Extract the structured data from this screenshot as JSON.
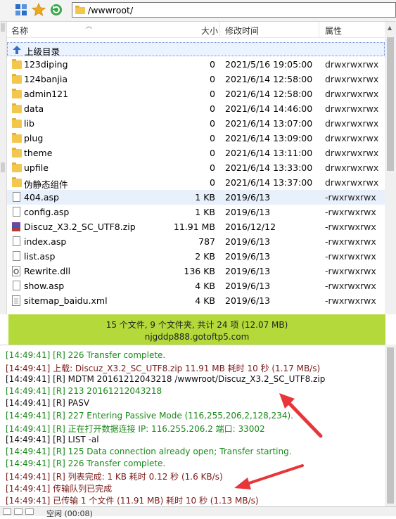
{
  "toolbar": {
    "path": "/wwwroot/"
  },
  "columns": {
    "name": "名称",
    "size": "大小",
    "modified": "修改时间",
    "attributes": "属性"
  },
  "parent_dir": "上级目录",
  "files": [
    {
      "name": "123diping",
      "size": "0",
      "modified": "2021/5/16 19:05:00",
      "attr": "drwxrwxrwx",
      "type": "folder"
    },
    {
      "name": "124banjia",
      "size": "0",
      "modified": "2021/6/14 12:58:00",
      "attr": "drwxrwxrwx",
      "type": "folder"
    },
    {
      "name": "admin121",
      "size": "0",
      "modified": "2021/6/14 12:58:00",
      "attr": "drwxrwxrwx",
      "type": "folder"
    },
    {
      "name": "data",
      "size": "0",
      "modified": "2021/6/14 14:46:00",
      "attr": "drwxrwxrwx",
      "type": "folder"
    },
    {
      "name": "lib",
      "size": "0",
      "modified": "2021/6/14 13:07:00",
      "attr": "drwxrwxrwx",
      "type": "folder"
    },
    {
      "name": "plug",
      "size": "0",
      "modified": "2021/6/14 13:09:00",
      "attr": "drwxrwxrwx",
      "type": "folder"
    },
    {
      "name": "theme",
      "size": "0",
      "modified": "2021/6/14 13:11:00",
      "attr": "drwxrwxrwx",
      "type": "folder"
    },
    {
      "name": "upfile",
      "size": "0",
      "modified": "2021/6/14 13:33:00",
      "attr": "drwxrwxrwx",
      "type": "folder"
    },
    {
      "name": "伪静态组件",
      "size": "0",
      "modified": "2021/6/14 13:37:00",
      "attr": "drwxrwxrwx",
      "type": "folder"
    },
    {
      "name": "404.asp",
      "size": "1 KB",
      "modified": "2019/6/13",
      "attr": "-rwxrwxrwx",
      "type": "file"
    },
    {
      "name": "config.asp",
      "size": "1 KB",
      "modified": "2019/6/13",
      "attr": "-rwxrwxrwx",
      "type": "file"
    },
    {
      "name": "Discuz_X3.2_SC_UTF8.zip",
      "size": "11.91 MB",
      "modified": "2016/12/12",
      "attr": "-rwxrwxrwx",
      "type": "archive"
    },
    {
      "name": "index.asp",
      "size": "787",
      "modified": "2019/6/13",
      "attr": "-rwxrwxrwx",
      "type": "file"
    },
    {
      "name": "list.asp",
      "size": "2 KB",
      "modified": "2019/6/13",
      "attr": "-rwxrwxrwx",
      "type": "file"
    },
    {
      "name": "Rewrite.dll",
      "size": "136 KB",
      "modified": "2019/6/13",
      "attr": "-rwxrwxrwx",
      "type": "dll"
    },
    {
      "name": "show.asp",
      "size": "4 KB",
      "modified": "2019/6/13",
      "attr": "-rwxrwxrwx",
      "type": "file"
    },
    {
      "name": "sitemap_baidu.xml",
      "size": "4 KB",
      "modified": "2019/6/13",
      "attr": "-rwxrwxrwx",
      "type": "xml"
    }
  ],
  "status": {
    "summary": "15 个文件, 9 个文件夹, 共计 24 项 (12.07 MB)",
    "host": "njgddp888.gotoftp5.com"
  },
  "log": [
    {
      "text": "[14:49:41] [R] 226 Transfer complete.",
      "color": "#1a8a1a"
    },
    {
      "text": "[14:49:41] 上载: Discuz_X3.2_SC_UTF8.zip 11.91 MB 耗时 10 秒 (1.17 MB/s)",
      "color": "#7a1a1a"
    },
    {
      "text": "[14:49:41] [R] MDTM 20161212043218 /wwwroot/Discuz_X3.2_SC_UTF8.zip",
      "color": "#111111"
    },
    {
      "text": "[14:49:41] [R] 213 20161212043218",
      "color": "#1a8a1a"
    },
    {
      "text": "[14:49:41] [R] PASV",
      "color": "#111111"
    },
    {
      "text": "[14:49:41] [R] 227 Entering Passive Mode (116,255,206,2,128,234).",
      "color": "#1a8a1a"
    },
    {
      "text": "[14:49:41] [R] 正在打开数据连接 IP: 116.255.206.2 端口: 33002",
      "color": "#1a8a1a"
    },
    {
      "text": "[14:49:41] [R] LIST -al",
      "color": "#111111"
    },
    {
      "text": "[14:49:41] [R] 125 Data connection already open; Transfer starting.",
      "color": "#1a8a1a"
    },
    {
      "text": "[14:49:41] [R] 226 Transfer complete.",
      "color": "#1a8a1a"
    },
    {
      "text": "[14:49:41] [R] 列表完成: 1 KB 耗时 0.12 秒 (1.6 KB/s)",
      "color": "#7a1a1a"
    },
    {
      "text": "[14:49:41] 传输队列已完成",
      "color": "#7a1a1a"
    },
    {
      "text": "[14:49:41] 已传输 1 个文件 (11.91 MB) 耗时 10 秒 (1.13 MB/s)",
      "color": "#7a1a1a"
    }
  ],
  "bottombar": {
    "state": "空闲 (00:08)"
  },
  "colors": {
    "status_bar": "#b4d93a",
    "log_green": "#1a8a1a",
    "log_red": "#7a1a1a",
    "arrow": "#e8353a"
  }
}
